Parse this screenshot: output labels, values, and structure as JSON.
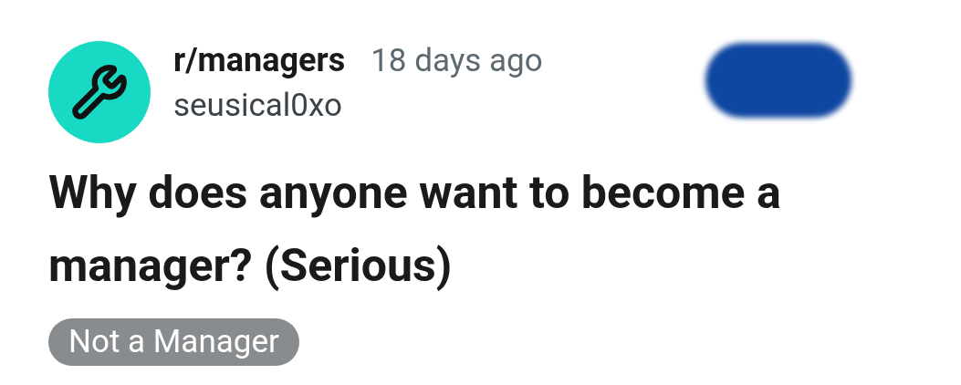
{
  "post": {
    "subreddit": "r/managers",
    "time": "18 days ago",
    "author": "seusical0xo",
    "title": "Why does anyone want to become a manager? (Serious)",
    "flair": "Not a Manager"
  }
}
